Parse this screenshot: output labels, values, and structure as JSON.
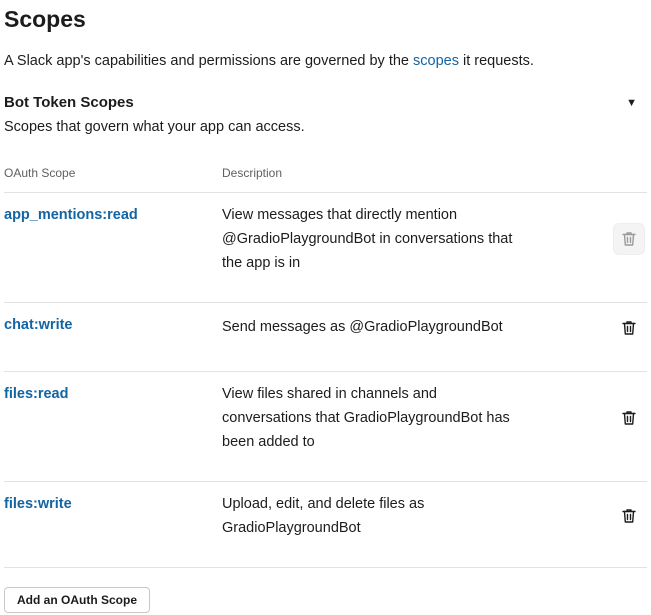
{
  "page": {
    "title": "Scopes",
    "intro_before_link": "A Slack app's capabilities and permissions are governed by the ",
    "intro_link": "scopes",
    "intro_after_link": " it requests."
  },
  "section": {
    "title": "Bot Token Scopes",
    "subtitle": "Scopes that govern what your app can access.",
    "toggle_icon": "caret-down-icon"
  },
  "table": {
    "headers": [
      "OAuth Scope",
      "Description"
    ],
    "rows": [
      {
        "scope": "app_mentions:read",
        "description": [
          "View messages that directly mention",
          "@GradioPlaygroundBot in conversations that",
          "the app is in"
        ],
        "action_icon": "trash-icon"
      },
      {
        "scope": "chat:write",
        "description": [
          "Send messages as @GradioPlaygroundBot"
        ],
        "action_icon": "trash-icon"
      },
      {
        "scope": "files:read",
        "description": [
          "View files shared in channels and",
          "conversations that GradioPlaygroundBot has",
          "been added to"
        ],
        "action_icon": "trash-icon"
      },
      {
        "scope": "files:write",
        "description": [
          "Upload, edit, and delete files as",
          "GradioPlaygroundBot"
        ],
        "action_icon": "trash-icon"
      }
    ]
  },
  "actions": {
    "add_scope_label": "Add an OAuth Scope"
  },
  "colors": {
    "link": "#1264a3",
    "text": "#1d1c1d",
    "muted": "#616061",
    "divider": "#e2e2e2"
  }
}
